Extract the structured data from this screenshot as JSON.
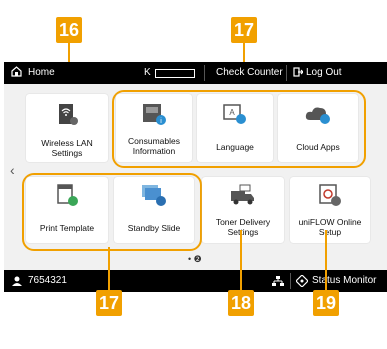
{
  "topbar": {
    "home_label": "Home",
    "toner_label": "K",
    "check_counter_label": "Check Counter",
    "log_out_label": "Log Out"
  },
  "tiles": {
    "wireless": "Wireless LAN Settings",
    "consumables": "Consumables Information",
    "language": "Language",
    "cloud": "Cloud Apps",
    "print_template": "Print Template",
    "standby_slide": "Standby Slide",
    "toner_delivery": "Toner Delivery Settings",
    "uniflow": "uniFLOW Online Setup"
  },
  "bottombar": {
    "user_id": "7654321",
    "status_monitor_label": "Status Monitor"
  },
  "callouts": {
    "c16": "16",
    "c17_top": "17",
    "c17_bottom": "17",
    "c18": "18",
    "c19": "19"
  },
  "colors": {
    "accent": "#f1a000",
    "bar": "#000000",
    "panel": "#f1f1f1"
  }
}
